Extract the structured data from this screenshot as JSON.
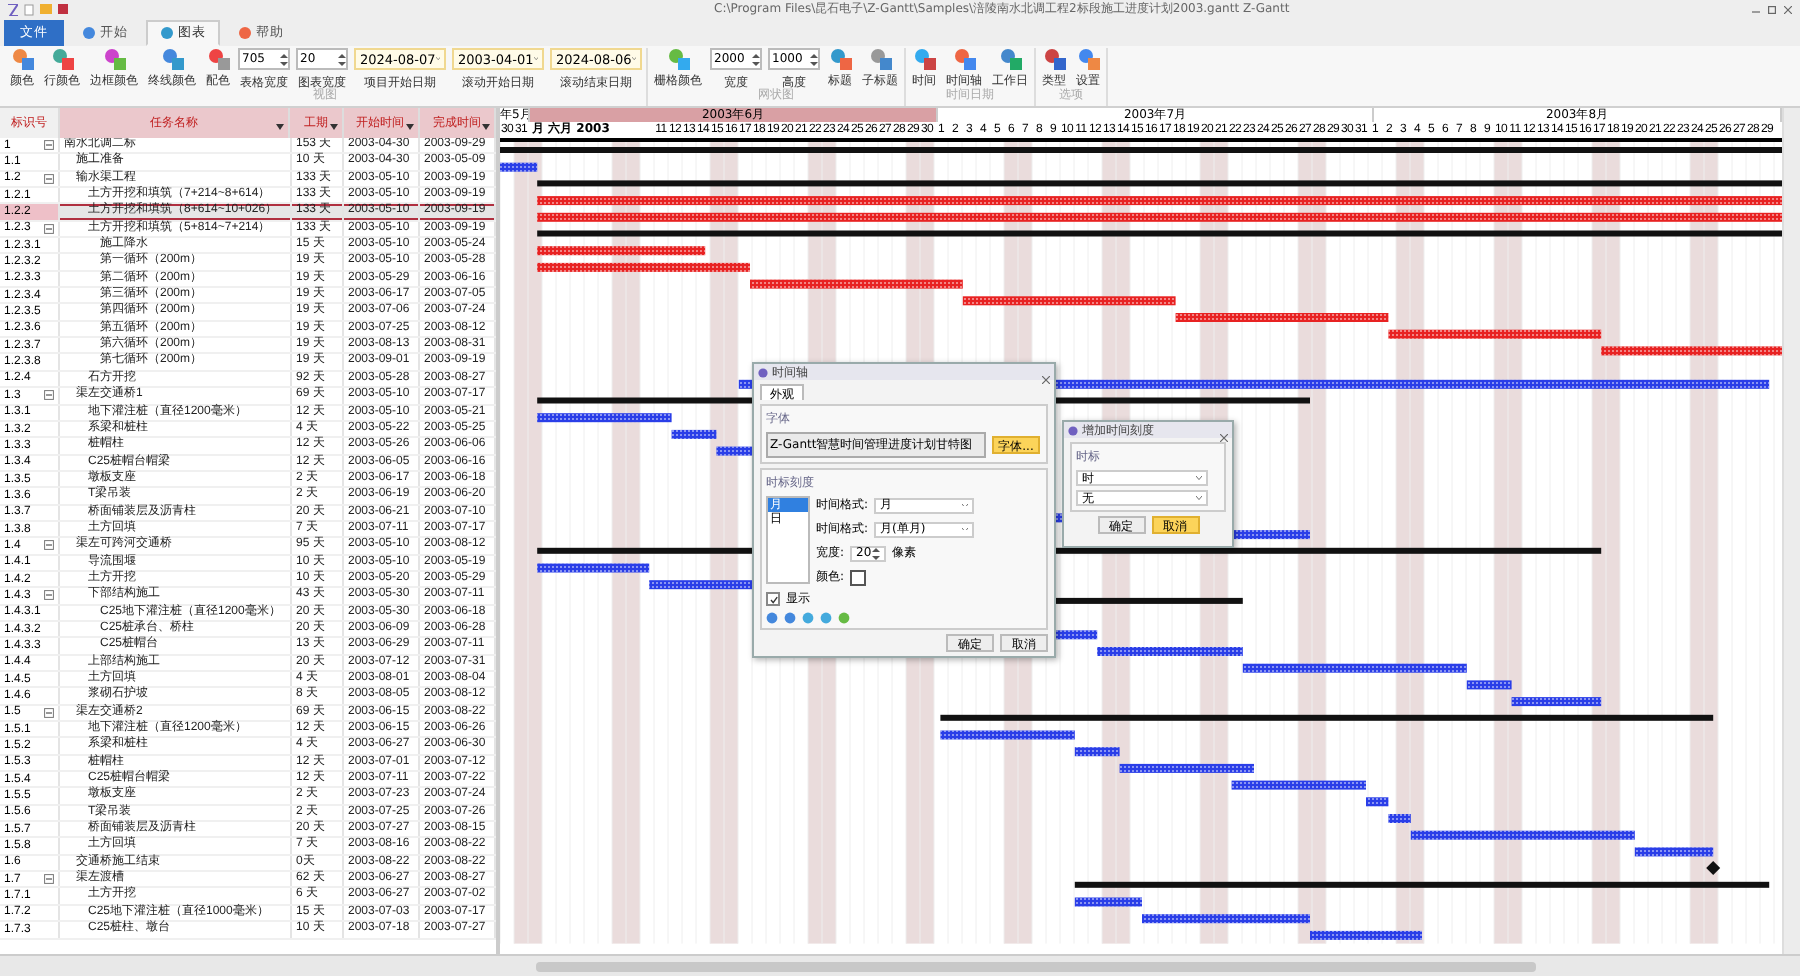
{
  "window": {
    "title": "C:\\Program Files\\昆石电子\\Z-Gantt\\Samples\\涪陵南水北调工程2标段施工进度计划2003.gantt   Z-Gantt"
  },
  "ribbon_tabs": [
    {
      "label": "文件",
      "kind": "file",
      "selected": false
    },
    {
      "label": "开始",
      "kind": "tab",
      "selected": false
    },
    {
      "label": "图表",
      "kind": "tab",
      "selected": true
    },
    {
      "label": "帮助",
      "kind": "tab",
      "selected": false
    }
  ],
  "ribbon_groups": [
    {
      "label": "视图",
      "items": [
        {
          "kind": "button",
          "label": "颜色"
        },
        {
          "kind": "button",
          "label": "行颜色"
        },
        {
          "kind": "button",
          "label": "边框颜色"
        },
        {
          "kind": "button",
          "label": "终线颜色"
        },
        {
          "kind": "button",
          "label": "配色"
        },
        {
          "kind": "spin",
          "value": "705",
          "label": "表格宽度"
        },
        {
          "kind": "spin",
          "value": "20",
          "label": "图表宽度"
        },
        {
          "kind": "date",
          "value": "2024-08-07",
          "label": "项目开始日期"
        },
        {
          "kind": "date",
          "value": "2003-04-01",
          "label": "滚动开始日期"
        },
        {
          "kind": "date",
          "value": "2024-08-06",
          "label": "滚动结束日期"
        }
      ]
    },
    {
      "label": "网状图",
      "items": [
        {
          "kind": "button",
          "label": "栅格颜色"
        },
        {
          "kind": "spin",
          "value": "2000",
          "label": "宽度"
        },
        {
          "kind": "spin",
          "value": "1000",
          "label": "高度"
        },
        {
          "kind": "button",
          "label": "标题"
        },
        {
          "kind": "button",
          "label": "子标题"
        }
      ]
    },
    {
      "label": "时间日期",
      "items": [
        {
          "kind": "menu",
          "label": "时间"
        },
        {
          "kind": "button",
          "label": "时间轴"
        },
        {
          "kind": "button",
          "label": "工作日"
        }
      ]
    },
    {
      "label": "选项",
      "items": [
        {
          "kind": "menu",
          "label": "类型"
        },
        {
          "kind": "button",
          "label": "设置"
        }
      ]
    }
  ],
  "columns": [
    {
      "label": "标识号",
      "filter": false
    },
    {
      "label": "任务名称",
      "filter": true
    },
    {
      "label": "工期",
      "filter": true
    },
    {
      "label": "开始时间",
      "filter": true
    },
    {
      "label": "完成时间",
      "filter": true
    }
  ],
  "timeline": {
    "months": [
      {
        "label": "年5月",
        "selected": false
      },
      {
        "label": "2003年6月",
        "selected": true
      },
      {
        "label": "2003年7月",
        "selected": false
      },
      {
        "label": "2003年8月",
        "selected": false
      }
    ],
    "days": [
      {
        "kind": "day",
        "label": "30"
      },
      {
        "kind": "day",
        "label": "31"
      },
      {
        "kind": "caption",
        "label": "月 六月 2003"
      },
      {
        "kind": "day",
        "label": "11"
      },
      {
        "kind": "day",
        "label": "12"
      },
      {
        "kind": "day",
        "label": "13"
      },
      {
        "kind": "day",
        "label": "14"
      },
      {
        "kind": "day",
        "label": "15"
      },
      {
        "kind": "day",
        "label": "16"
      },
      {
        "kind": "day",
        "label": "17"
      },
      {
        "kind": "day",
        "label": "18"
      },
      {
        "kind": "day",
        "label": "19"
      },
      {
        "kind": "day",
        "label": "20"
      },
      {
        "kind": "day",
        "label": "21"
      },
      {
        "kind": "day",
        "label": "22"
      },
      {
        "kind": "day",
        "label": "23"
      },
      {
        "kind": "day",
        "label": "24"
      },
      {
        "kind": "day",
        "label": "25"
      },
      {
        "kind": "day",
        "label": "26"
      },
      {
        "kind": "day",
        "label": "27"
      },
      {
        "kind": "day",
        "label": "28"
      },
      {
        "kind": "day",
        "label": "29"
      },
      {
        "kind": "day",
        "label": "30"
      },
      {
        "kind": "day",
        "label": "1"
      },
      {
        "kind": "day",
        "label": "2"
      },
      {
        "kind": "day",
        "label": "3"
      },
      {
        "kind": "day",
        "label": "4"
      },
      {
        "kind": "day",
        "label": "5"
      },
      {
        "kind": "day",
        "label": "6"
      },
      {
        "kind": "day",
        "label": "7"
      },
      {
        "kind": "day",
        "label": "8"
      },
      {
        "kind": "day",
        "label": "9"
      },
      {
        "kind": "day",
        "label": "10"
      },
      {
        "kind": "day",
        "label": "11"
      },
      {
        "kind": "day",
        "label": "12"
      },
      {
        "kind": "day",
        "label": "13"
      },
      {
        "kind": "day",
        "label": "14"
      },
      {
        "kind": "day",
        "label": "15"
      },
      {
        "kind": "day",
        "label": "16"
      },
      {
        "kind": "day",
        "label": "17"
      },
      {
        "kind": "day",
        "label": "18"
      },
      {
        "kind": "day",
        "label": "19"
      },
      {
        "kind": "day",
        "label": "20"
      },
      {
        "kind": "day",
        "label": "21"
      },
      {
        "kind": "day",
        "label": "22"
      },
      {
        "kind": "day",
        "label": "23"
      },
      {
        "kind": "day",
        "label": "24"
      },
      {
        "kind": "day",
        "label": "25"
      },
      {
        "kind": "day",
        "label": "26"
      },
      {
        "kind": "day",
        "label": "27"
      },
      {
        "kind": "day",
        "label": "28"
      },
      {
        "kind": "day",
        "label": "29"
      },
      {
        "kind": "day",
        "label": "30"
      },
      {
        "kind": "day",
        "label": "31"
      },
      {
        "kind": "day",
        "label": "1"
      },
      {
        "kind": "day",
        "label": "2"
      },
      {
        "kind": "day",
        "label": "3"
      },
      {
        "kind": "day",
        "label": "4"
      },
      {
        "kind": "day",
        "label": "5"
      },
      {
        "kind": "day",
        "label": "6"
      },
      {
        "kind": "day",
        "label": "7"
      },
      {
        "kind": "day",
        "label": "8"
      },
      {
        "kind": "day",
        "label": "9"
      },
      {
        "kind": "day",
        "label": "10"
      },
      {
        "kind": "day",
        "label": "11"
      },
      {
        "kind": "day",
        "label": "12"
      },
      {
        "kind": "day",
        "label": "13"
      },
      {
        "kind": "day",
        "label": "14"
      },
      {
        "kind": "day",
        "label": "15"
      },
      {
        "kind": "day",
        "label": "16"
      },
      {
        "kind": "day",
        "label": "17"
      },
      {
        "kind": "day",
        "label": "18"
      },
      {
        "kind": "day",
        "label": "19"
      },
      {
        "kind": "day",
        "label": "20"
      },
      {
        "kind": "day",
        "label": "21"
      },
      {
        "kind": "day",
        "label": "22"
      },
      {
        "kind": "day",
        "label": "23"
      },
      {
        "kind": "day",
        "label": "24"
      },
      {
        "kind": "day",
        "label": "25"
      },
      {
        "kind": "day",
        "label": "26"
      },
      {
        "kind": "day",
        "label": "27"
      },
      {
        "kind": "day",
        "label": "28"
      },
      {
        "kind": "day",
        "label": "29"
      }
    ]
  },
  "tasks": [
    {
      "id": "1",
      "name": "南水北调二标",
      "duration": "153 天",
      "start": "2003-04-30",
      "end": "2003-09-29",
      "kind": "summary",
      "critical": false,
      "selected": false,
      "expanded": true,
      "children": [
        {
          "id": "1.1",
          "name": "施工准备",
          "duration": "10 天",
          "start": "2003-04-30",
          "end": "2003-05-09",
          "kind": "task",
          "critical": false,
          "selected": false
        },
        {
          "id": "1.2",
          "name": "输水渠工程",
          "duration": "133 天",
          "start": "2003-05-10",
          "end": "2003-09-19",
          "kind": "summary",
          "critical": false,
          "selected": false,
          "expanded": true,
          "children": [
            {
              "id": "1.2.1",
              "name": "土方开挖和填筑（7+214~8+614）",
              "duration": "133 天",
              "start": "2003-05-10",
              "end": "2003-09-19",
              "kind": "task",
              "critical": true,
              "selected": false
            },
            {
              "id": "1.2.2",
              "name": "土方开挖和填筑（8+614~10+026）",
              "duration": "133 天",
              "start": "2003-05-10",
              "end": "2003-09-19",
              "kind": "task",
              "critical": true,
              "selected": true
            },
            {
              "id": "1.2.3",
              "name": "土方开挖和填筑（5+814~7+214）",
              "duration": "133 天",
              "start": "2003-05-10",
              "end": "2003-09-19",
              "kind": "summary",
              "critical": false,
              "selected": false,
              "expanded": true,
              "children": [
                {
                  "id": "1.2.3.1",
                  "name": "施工降水",
                  "duration": "15 天",
                  "start": "2003-05-10",
                  "end": "2003-05-24",
                  "kind": "task",
                  "critical": true,
                  "selected": false
                },
                {
                  "id": "1.2.3.2",
                  "name": "第一循环（200m）",
                  "duration": "19 天",
                  "start": "2003-05-10",
                  "end": "2003-05-28",
                  "kind": "task",
                  "critical": true,
                  "selected": false
                },
                {
                  "id": "1.2.3.3",
                  "name": "第二循环（200m）",
                  "duration": "19 天",
                  "start": "2003-05-29",
                  "end": "2003-06-16",
                  "kind": "task",
                  "critical": true,
                  "selected": false
                },
                {
                  "id": "1.2.3.4",
                  "name": "第三循环（200m）",
                  "duration": "19 天",
                  "start": "2003-06-17",
                  "end": "2003-07-05",
                  "kind": "task",
                  "critical": true,
                  "selected": false
                },
                {
                  "id": "1.2.3.5",
                  "name": "第四循环（200m）",
                  "duration": "19 天",
                  "start": "2003-07-06",
                  "end": "2003-07-24",
                  "kind": "task",
                  "critical": true,
                  "selected": false
                },
                {
                  "id": "1.2.3.6",
                  "name": "第五循环（200m）",
                  "duration": "19 天",
                  "start": "2003-07-25",
                  "end": "2003-08-12",
                  "kind": "task",
                  "critical": true,
                  "selected": false
                },
                {
                  "id": "1.2.3.7",
                  "name": "第六循环（200m）",
                  "duration": "19 天",
                  "start": "2003-08-13",
                  "end": "2003-08-31",
                  "kind": "task",
                  "critical": true,
                  "selected": false
                },
                {
                  "id": "1.2.3.8",
                  "name": "第七循环（200m）",
                  "duration": "19 天",
                  "start": "2003-09-01",
                  "end": "2003-09-19",
                  "kind": "task",
                  "selected": false
                }
              ]
            },
            {
              "id": "1.2.4",
              "name": "石方开挖",
              "duration": "92 天",
              "start": "2003-05-28",
              "end": "2003-08-27",
              "kind": "task",
              "critical": false,
              "selected": false
            }
          ]
        },
        {
          "id": "1.3",
          "name": "渠左交通桥1",
          "duration": "69 天",
          "start": "2003-05-10",
          "end": "2003-07-17",
          "kind": "summary",
          "critical": false,
          "selected": false,
          "expanded": true,
          "children": [
            {
              "id": "1.3.1",
              "name": "地下灌注桩（直径1200毫米）",
              "duration": "12 天",
              "start": "2003-05-10",
              "end": "2003-05-21",
              "kind": "task",
              "critical": false,
              "selected": false
            },
            {
              "id": "1.3.2",
              "name": "系梁和桩柱",
              "duration": "4 天",
              "start": "2003-05-22",
              "end": "2003-05-25",
              "kind": "task",
              "critical": false,
              "selected": false
            },
            {
              "id": "1.3.3",
              "name": "桩帽柱",
              "duration": "12 天",
              "start": "2003-05-26",
              "end": "2003-06-06",
              "kind": "task",
              "critical": false,
              "selected": false
            },
            {
              "id": "1.3.4",
              "name": "C25桩帽台帽梁",
              "duration": "12 天",
              "start": "2003-06-05",
              "end": "2003-06-16",
              "kind": "task",
              "selected": false
            },
            {
              "id": "1.3.5",
              "name": "墩板支座",
              "duration": "2 天",
              "start": "2003-06-17",
              "end": "2003-06-18",
              "kind": "task",
              "selected": false
            },
            {
              "id": "1.3.6",
              "name": "T梁吊装",
              "duration": "2 天",
              "start": "2003-06-19",
              "end": "2003-06-20",
              "kind": "task",
              "selected": false
            },
            {
              "id": "1.3.7",
              "name": "桥面铺装层及沥青柱",
              "duration": "20 天",
              "start": "2003-06-21",
              "end": "2003-07-10",
              "kind": "task",
              "selected": false
            },
            {
              "id": "1.3.8",
              "name": "土方回填",
              "duration": "7 天",
              "start": "2003-07-11",
              "end": "2003-07-17",
              "kind": "task",
              "critical": false,
              "selected": false
            }
          ]
        },
        {
          "id": "1.4",
          "name": "渠左可跨河交通桥",
          "duration": "95 天",
          "start": "2003-05-10",
          "end": "2003-08-12",
          "kind": "summary",
          "critical": false,
          "selected": false,
          "expanded": true,
          "children": [
            {
              "id": "1.4.1",
              "name": "导流围堰",
              "duration": "10 天",
              "start": "2003-05-10",
              "end": "2003-05-19",
              "kind": "task",
              "critical": false,
              "selected": false
            },
            {
              "id": "1.4.2",
              "name": "土方开挖",
              "duration": "10 天",
              "start": "2003-05-20",
              "end": "2003-05-29",
              "kind": "task",
              "critical": false,
              "selected": false
            },
            {
              "id": "1.4.3",
              "name": "下部结构施工",
              "duration": "43 天",
              "start": "2003-05-30",
              "end": "2003-07-11",
              "kind": "summary",
              "critical": false,
              "selected": false,
              "expanded": true,
              "children": [
                {
                  "id": "1.4.3.1",
                  "name": "C25地下灌注桩（直径1200毫米）",
                  "duration": "20 天",
                  "start": "2003-05-30",
                  "end": "2003-06-18",
                  "kind": "task",
                  "selected": false
                },
                {
                  "id": "1.4.3.2",
                  "name": "C25桩承台、桥柱",
                  "duration": "20 天",
                  "start": "2003-06-09",
                  "end": "2003-06-28",
                  "kind": "task",
                  "critical": false,
                  "selected": false
                },
                {
                  "id": "1.4.3.3",
                  "name": "C25桩帽台",
                  "duration": "13 天",
                  "start": "2003-06-29",
                  "end": "2003-07-11",
                  "kind": "task",
                  "critical": false,
                  "selected": false
                }
              ]
            },
            {
              "id": "1.4.4",
              "name": "上部结构施工",
              "duration": "20 天",
              "start": "2003-07-12",
              "end": "2003-07-31",
              "kind": "task",
              "critical": false,
              "selected": false
            },
            {
              "id": "1.4.5",
              "name": "土方回填",
              "duration": "4 天",
              "start": "2003-08-01",
              "end": "2003-08-04",
              "kind": "task",
              "critical": false,
              "selected": false
            },
            {
              "id": "1.4.6",
              "name": "浆砌石护坡",
              "duration": "8 天",
              "start": "2003-08-05",
              "end": "2003-08-12",
              "kind": "task",
              "critical": false,
              "selected": false
            }
          ]
        },
        {
          "id": "1.5",
          "name": "渠左交通桥2",
          "duration": "69 天",
          "start": "2003-06-15",
          "end": "2003-08-22",
          "kind": "summary",
          "critical": false,
          "selected": false,
          "expanded": true,
          "children": [
            {
              "id": "1.5.1",
              "name": "地下灌注桩（直径1200毫米）",
              "duration": "12 天",
              "start": "2003-06-15",
              "end": "2003-06-26",
              "kind": "task",
              "critical": false,
              "selected": false
            },
            {
              "id": "1.5.2",
              "name": "系梁和桩柱",
              "duration": "4 天",
              "start": "2003-06-27",
              "end": "2003-06-30",
              "kind": "task",
              "critical": false,
              "selected": false
            },
            {
              "id": "1.5.3",
              "name": "桩帽柱",
              "duration": "12 天",
              "start": "2003-07-01",
              "end": "2003-07-12",
              "kind": "task",
              "critical": false,
              "selected": false
            },
            {
              "id": "1.5.4",
              "name": "C25桩帽台帽梁",
              "duration": "12 天",
              "start": "2003-07-11",
              "end": "2003-07-22",
              "kind": "task",
              "critical": false,
              "selected": false
            },
            {
              "id": "1.5.5",
              "name": "墩板支座",
              "duration": "2 天",
              "start": "2003-07-23",
              "end": "2003-07-24",
              "kind": "task",
              "critical": false,
              "selected": false
            },
            {
              "id": "1.5.6",
              "name": "T梁吊装",
              "duration": "2 天",
              "start": "2003-07-25",
              "end": "2003-07-26",
              "kind": "task",
              "critical": false,
              "selected": false
            },
            {
              "id": "1.5.7",
              "name": "桥面铺装层及沥青柱",
              "duration": "20 天",
              "start": "2003-07-27",
              "end": "2003-08-15",
              "kind": "task",
              "critical": false,
              "selected": false
            },
            {
              "id": "1.5.8",
              "name": "土方回填",
              "duration": "7 天",
              "start": "2003-08-16",
              "end": "2003-08-22",
              "kind": "task",
              "critical": false,
              "selected": false
            }
          ]
        },
        {
          "id": "1.6",
          "name": "交通桥施工结束",
          "duration": "0天",
          "start": "2003-08-22",
          "end": "2003-08-22",
          "kind": "milestone",
          "critical": false,
          "selected": false
        },
        {
          "id": "1.7",
          "name": "渠左渡槽",
          "duration": "62 天",
          "start": "2003-06-27",
          "end": "2003-08-27",
          "kind": "summary",
          "critical": false,
          "selected": false,
          "expanded": true,
          "children": [
            {
              "id": "1.7.1",
              "name": "土方开挖",
              "duration": "6 天",
              "start": "2003-06-27",
              "end": "2003-07-02",
              "kind": "task",
              "critical": false,
              "selected": false
            },
            {
              "id": "1.7.2",
              "name": "C25地下灌注桩（直径1000毫米）",
              "duration": "15 天",
              "start": "2003-07-03",
              "end": "2003-07-17",
              "kind": "task",
              "critical": false,
              "selected": false
            },
            {
              "id": "1.7.3",
              "name": "C25桩柱、墩台",
              "duration": "10 天",
              "start": "2003-07-18",
              "end": "2003-07-27",
              "kind": "task",
              "critical": false,
              "selected": false
            }
          ]
        }
      ]
    }
  ],
  "timeline_dialog": {
    "title": "时间轴",
    "tabs": [
      {
        "label": "外观",
        "selected": true
      }
    ],
    "font_group": "字体",
    "font_sample": "Z-Gantt智慧时间管理进度计划甘特图",
    "font_button": "字体...",
    "scale_group": "时标刻度",
    "scales": [
      {
        "label": "月",
        "selected": true
      },
      {
        "label": "日",
        "selected": false
      }
    ],
    "fields": [
      {
        "label": "时间格式:",
        "value": "月"
      },
      {
        "label": "时间格式:",
        "value": "月(单月)"
      }
    ],
    "width_label": "宽度:",
    "width_value": "20",
    "width_unit": "像素",
    "color_label": "颜色:",
    "show": {
      "label": "显示",
      "checked": true
    },
    "ok": "确定",
    "cancel": "取消"
  },
  "scale_dialog": {
    "title": "增加时间刻度",
    "group": "时标",
    "fields": [
      "时",
      "无"
    ],
    "ok": "确定",
    "cancel": "取消"
  }
}
